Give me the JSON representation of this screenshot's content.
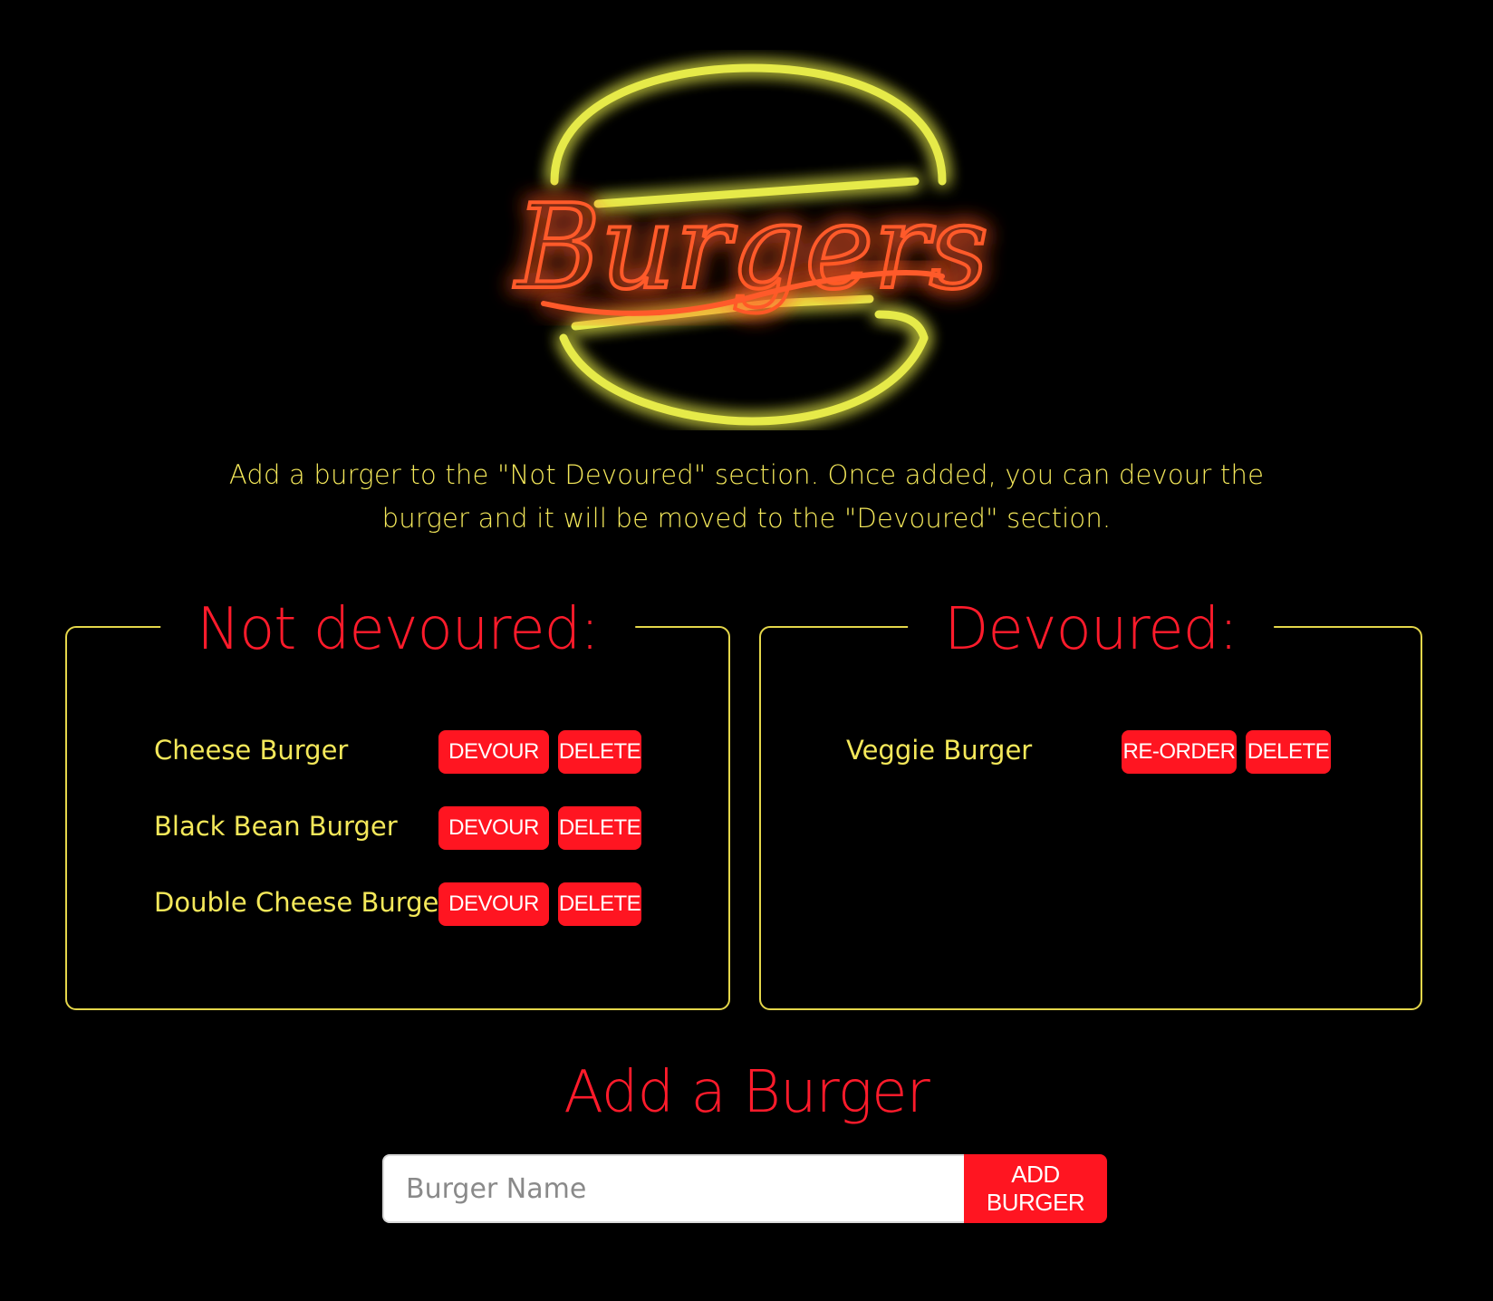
{
  "logo": {
    "text": "Burgers",
    "colors": {
      "bun": "#e6ea48",
      "text": "#ff5a2c",
      "glow": "#ff1a1a"
    }
  },
  "intro": {
    "line1": "Add a burger to the \"Not Devoured\" section. Once added, you can devour the",
    "line2": "burger and it will be moved to the \"Devoured\" section."
  },
  "not_devoured": {
    "title": "Not devoured:",
    "items": [
      {
        "name": "Cheese Burger",
        "action_label": "DEVOUR",
        "delete_label": "DELETE"
      },
      {
        "name": "Black Bean Burger",
        "action_label": "DEVOUR",
        "delete_label": "DELETE"
      },
      {
        "name": "Double Cheese Burger",
        "action_label": "DEVOUR",
        "delete_label": "DELETE"
      }
    ]
  },
  "devoured": {
    "title": "Devoured:",
    "items": [
      {
        "name": "Veggie Burger",
        "action_label": "RE-ORDER",
        "delete_label": "DELETE"
      }
    ]
  },
  "add_form": {
    "title": "Add a Burger",
    "input_value": "",
    "input_placeholder": "Burger Name",
    "button_label": "ADD BURGER"
  },
  "theme": {
    "background": "#000000",
    "accent_red": "#ff1521",
    "text_yellow": "#f4e85a",
    "border_yellow": "#e4d64a"
  }
}
